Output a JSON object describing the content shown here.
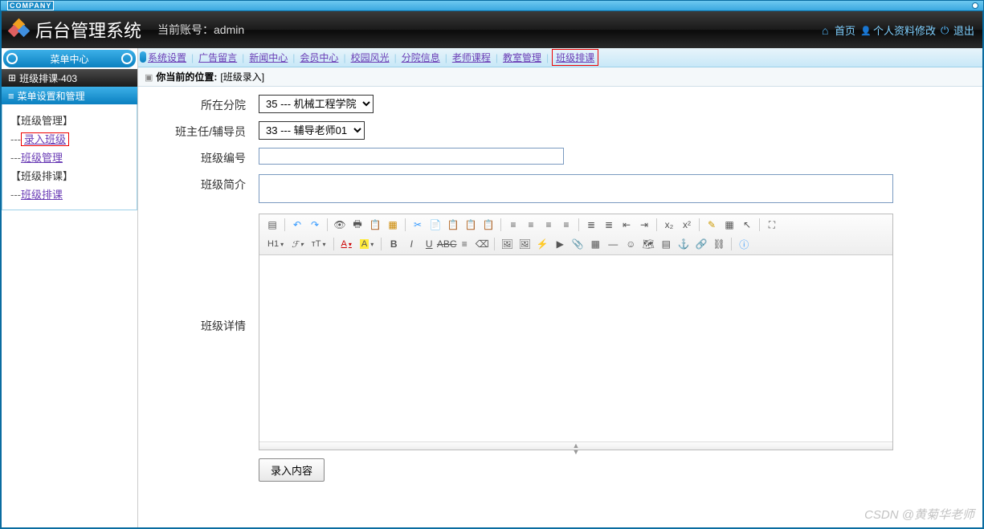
{
  "brand": {
    "badge": "COMPANY",
    "system_title": "后台管理系统",
    "account_prefix": "当前账号：",
    "account_name": "admin"
  },
  "header_links": {
    "home": "首页",
    "profile": "个人资料修改",
    "logout": "退出"
  },
  "sidebar": {
    "center_title": "菜单中心",
    "crumb": "班级排课-403",
    "section_title": "菜单设置和管理",
    "groups": [
      {
        "title": "【班级管理】",
        "items": [
          {
            "label": "录入班级",
            "highlight": true
          },
          {
            "label": "班级管理",
            "highlight": false
          }
        ]
      },
      {
        "title": "【班级排课】",
        "items": [
          {
            "label": "班级排课",
            "highlight": false
          }
        ]
      }
    ]
  },
  "tabs": [
    {
      "label": "系统设置",
      "active": false
    },
    {
      "label": "广告留言",
      "active": false
    },
    {
      "label": "新闻中心",
      "active": false
    },
    {
      "label": "会员中心",
      "active": false
    },
    {
      "label": "校园风光",
      "active": false
    },
    {
      "label": "分院信息",
      "active": false
    },
    {
      "label": "老师课程",
      "active": false
    },
    {
      "label": "教室管理",
      "active": false
    },
    {
      "label": "班级排课",
      "active": true
    }
  ],
  "location": {
    "prefix": "你当前的位置:",
    "value": "[班级录入]"
  },
  "form": {
    "college": {
      "label": "所在分院",
      "selected": "35 --- 机械工程学院"
    },
    "headteacher": {
      "label": "班主任/辅导员",
      "selected": "33 --- 辅导老师01"
    },
    "class_no": {
      "label": "班级编号",
      "value": ""
    },
    "class_brief": {
      "label": "班级简介",
      "value": ""
    },
    "class_detail": {
      "label": "班级详情",
      "value": ""
    },
    "submit": "录入内容"
  },
  "watermark": "CSDN @黄菊华老师"
}
